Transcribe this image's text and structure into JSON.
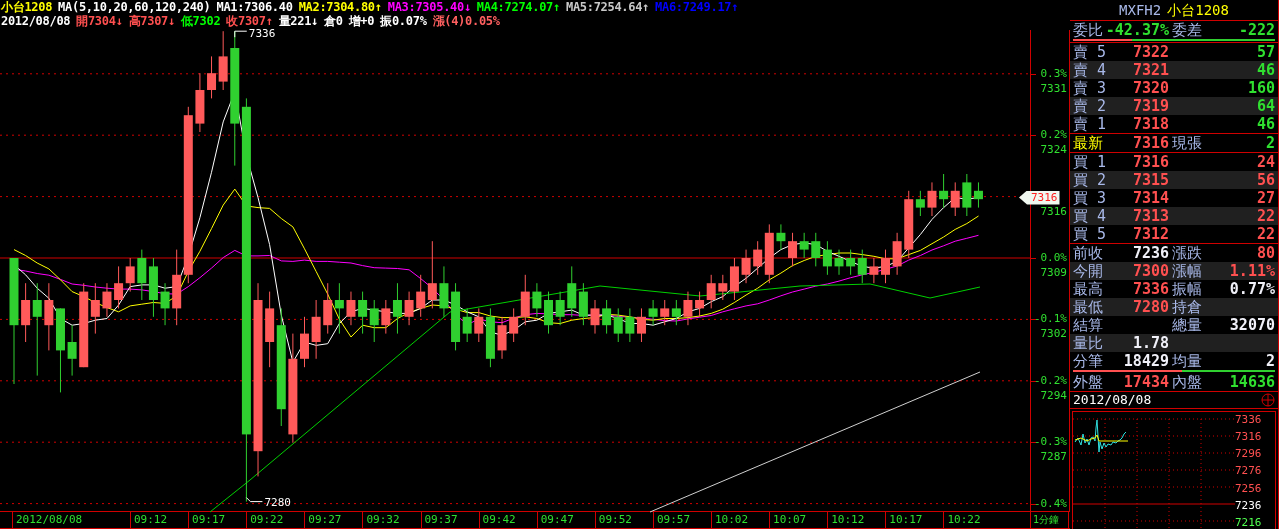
{
  "header": {
    "line1": [
      {
        "text": "小台1208",
        "color": "#ffff00"
      },
      {
        "text": "MA(5,10,20,60,120,240)",
        "color": "#ffffff"
      },
      {
        "text": "MA1:7306.40",
        "color": "#ffffff"
      },
      {
        "text": "MA2:7304.80↑",
        "color": "#ffff00"
      },
      {
        "text": "MA3:7305.40↓",
        "color": "#ff00ff"
      },
      {
        "text": "MA4:7274.07↑",
        "color": "#00ff00"
      },
      {
        "text": "MA5:7254.64↑",
        "color": "#c8c8c8"
      },
      {
        "text": "MA6:7249.17↑",
        "color": "#0000ff"
      }
    ],
    "line2": [
      {
        "text": "2012/08/08",
        "color": "#ffffff"
      },
      {
        "text": "開7304↓",
        "color": "#ff5050"
      },
      {
        "text": "高7307↓",
        "color": "#ff5050"
      },
      {
        "text": "低7302",
        "color": "#00ff00"
      },
      {
        "text": "收7307↑",
        "color": "#ff5050"
      },
      {
        "text": "量221↓",
        "color": "#ffffff"
      },
      {
        "text": "倉0",
        "color": "#ffffff"
      },
      {
        "text": "增+0",
        "color": "#ffffff"
      },
      {
        "text": "振0.07%",
        "color": "#ffffff"
      },
      {
        "text": "漲(4)0.05%",
        "color": "#ff6060"
      }
    ]
  },
  "chart": {
    "high_label": "7336",
    "low_label": "7280",
    "last_price_tag": "7316",
    "y_labels": [
      {
        "percent": "0.3%",
        "price": "7331"
      },
      {
        "percent": "0.2%",
        "price": "7324"
      },
      {
        "price": "7316"
      },
      {
        "percent": "0.0%",
        "price": "7309"
      },
      {
        "percent": "-0.1%",
        "price": "7302"
      },
      {
        "percent": "-0.2%",
        "price": "7294"
      },
      {
        "percent": "-0.3%",
        "price": "7287"
      },
      {
        "percent": "-0.4%"
      }
    ],
    "x_labels": [
      "2012/08/08",
      "09:12",
      "09:17",
      "09:22",
      "09:27",
      "09:32",
      "09:37",
      "09:42",
      "09:47",
      "09:52",
      "09:57",
      "10:02",
      "10:07",
      "10:12",
      "10:17",
      "10:22"
    ],
    "interval": "1分鐘"
  },
  "quote": {
    "symbol": "MXFH2",
    "name": "小台1208",
    "ratio": {
      "label": "委比",
      "value": "-42.37%",
      "label2": "委差",
      "value2": "-222",
      "level": 0.29
    },
    "asks": [
      {
        "label": "賣 5",
        "price": "7322",
        "qty": "57"
      },
      {
        "label": "賣 4",
        "price": "7321",
        "qty": "46"
      },
      {
        "label": "賣 3",
        "price": "7320",
        "qty": "160"
      },
      {
        "label": "賣 2",
        "price": "7319",
        "qty": "64"
      },
      {
        "label": "賣 1",
        "price": "7318",
        "qty": "46"
      }
    ],
    "last": {
      "label": "最新",
      "price": "7316",
      "label2": "現張",
      "qty": "2"
    },
    "bids": [
      {
        "label": "買 1",
        "price": "7316",
        "qty": "24"
      },
      {
        "label": "買 2",
        "price": "7315",
        "qty": "56"
      },
      {
        "label": "買 3",
        "price": "7314",
        "qty": "27"
      },
      {
        "label": "買 4",
        "price": "7313",
        "qty": "22"
      },
      {
        "label": "買 5",
        "price": "7312",
        "qty": "22"
      }
    ],
    "stats": [
      {
        "items": [
          {
            "label": "前收",
            "value": "7236",
            "kind": "neutral"
          },
          {
            "label": "漲跌",
            "value": "80",
            "kind": "up"
          }
        ]
      },
      {
        "items": [
          {
            "label": "今開",
            "value": "7300",
            "kind": "up"
          },
          {
            "label": "漲幅",
            "value": "1.11%",
            "kind": "up"
          }
        ]
      },
      {
        "items": [
          {
            "label": "最高",
            "value": "7336",
            "kind": "up"
          },
          {
            "label": "振幅",
            "value": "0.77%",
            "kind": "neutral"
          }
        ]
      },
      {
        "items": [
          {
            "label": "最低",
            "value": "7280",
            "kind": "up"
          },
          {
            "label": "持倉"
          }
        ]
      },
      {
        "items": [
          {
            "label": "結算"
          },
          {
            "label": "總量",
            "value": "32070",
            "kind": "neutral"
          }
        ]
      },
      {
        "items": [
          {
            "label": "量比",
            "value": "1.78",
            "kind": "neutral"
          }
        ]
      },
      {
        "items": [
          {
            "label": "分筆",
            "value": "18429",
            "kind": "neutral"
          },
          {
            "label": "均量",
            "value": "2",
            "kind": "neutral"
          }
        ]
      }
    ],
    "outer_inner": {
      "label": "外盤",
      "value": "17434",
      "label2": "內盤",
      "value2": "14636",
      "level": 0.54
    }
  },
  "mini_chart": {
    "date": "2012/08/08",
    "y_labels": [
      {
        "text": "7336",
        "color": "#ff5050"
      },
      {
        "text": "7316",
        "color": "#ff5050"
      },
      {
        "text": "7296",
        "color": "#ff5050"
      },
      {
        "text": "7276",
        "color": "#ff5050"
      },
      {
        "text": "7256",
        "color": "#ff5050"
      },
      {
        "text": "7236",
        "color": "#ffffff"
      },
      {
        "text": "7216",
        "color": "#50ff50"
      }
    ]
  }
}
